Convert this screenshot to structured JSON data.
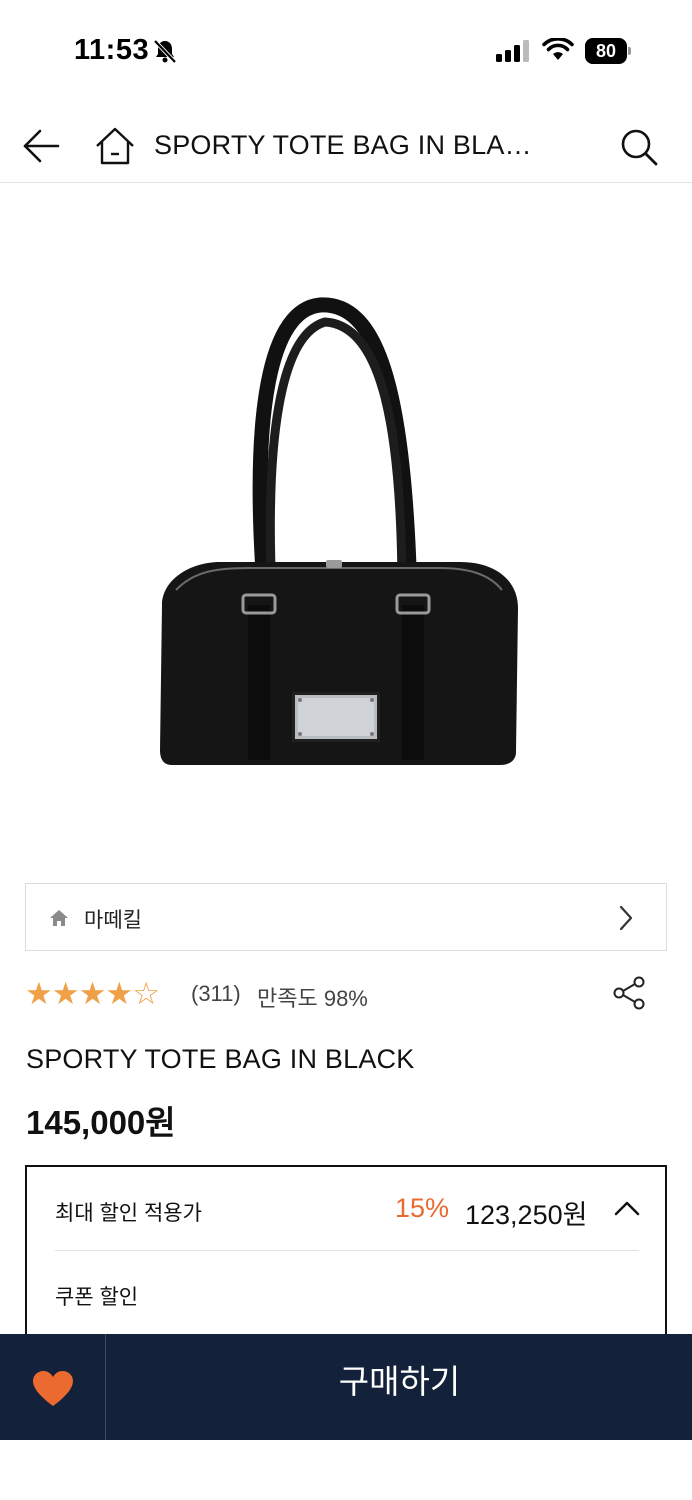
{
  "status_bar": {
    "time": "11:53",
    "battery": "80",
    "battery_level": 0.8
  },
  "header": {
    "title": "SPORTY TOTE BAG IN BLA…"
  },
  "brand": {
    "name": "마떼킬"
  },
  "rating": {
    "stars_filled": 4,
    "stars_total": 5,
    "review_count": "(311)",
    "satisfaction": "만족도 98%"
  },
  "product": {
    "name": "SPORTY TOTE BAG IN BLACK",
    "price": "145,000원"
  },
  "discount": {
    "label": "최대 할인 적용가",
    "percent": "15%",
    "price": "123,250원",
    "coupon_label": "쿠폰 할인"
  },
  "bottom_bar": {
    "buy_label": "구매하기"
  },
  "colors": {
    "accent": "#ea6a2f",
    "star": "#f0a046",
    "bottom_bar": "#13213a"
  }
}
